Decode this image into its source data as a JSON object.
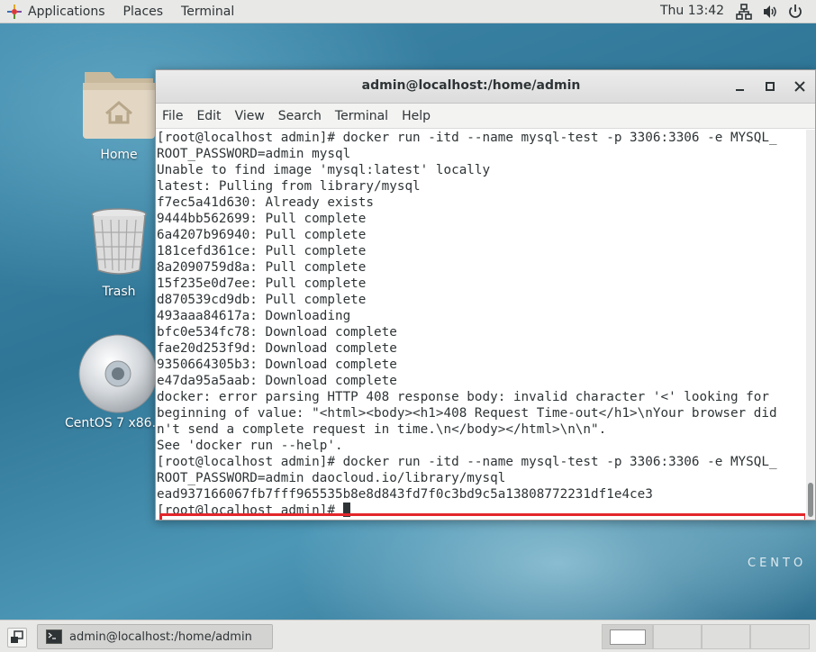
{
  "topbar": {
    "applications": "Applications",
    "places": "Places",
    "terminal": "Terminal",
    "clock": "Thu 13:42",
    "icons": [
      "network-icon",
      "volume-icon",
      "power-icon"
    ]
  },
  "desktop": {
    "icons": [
      {
        "label": "Home",
        "icon": "folder-home-icon"
      },
      {
        "label": "Trash",
        "icon": "trash-icon"
      },
      {
        "label": "CentOS 7 x86...",
        "icon": "disc-icon"
      }
    ],
    "brand": "CENTO"
  },
  "window": {
    "title": "admin@localhost:/home/admin",
    "menu": [
      "File",
      "Edit",
      "View",
      "Search",
      "Terminal",
      "Help"
    ],
    "lines": [
      "[root@localhost admin]# docker run -itd --name mysql-test -p 3306:3306 -e MYSQL_",
      "ROOT_PASSWORD=admin mysql",
      "Unable to find image 'mysql:latest' locally",
      "latest: Pulling from library/mysql",
      "f7ec5a41d630: Already exists",
      "9444bb562699: Pull complete",
      "6a4207b96940: Pull complete",
      "181cefd361ce: Pull complete",
      "8a2090759d8a: Pull complete",
      "15f235e0d7ee: Pull complete",
      "d870539cd9db: Pull complete",
      "493aaa84617a: Downloading",
      "bfc0e534fc78: Download complete",
      "fae20d253f9d: Download complete",
      "9350664305b3: Download complete",
      "e47da95a5aab: Download complete",
      "docker: error parsing HTTP 408 response body: invalid character '<' looking for",
      "beginning of value: \"<html><body><h1>408 Request Time-out</h1>\\nYour browser did",
      "n't send a complete request in time.\\n</body></html>\\n\\n\".",
      "See 'docker run --help'.",
      "[root@localhost admin]# docker run -itd --name mysql-test -p 3306:3306 -e MYSQL_",
      "ROOT_PASSWORD=admin daocloud.io/library/mysql",
      "ead937166067fb7fff965535b8e8d843fd7f0c3bd9c5a13808772231df1e4ce3"
    ],
    "prompt": "[root@localhost admin]# ",
    "highlight_color": "#e3262b"
  },
  "taskbar": {
    "task_label": "admin@localhost:/home/admin",
    "workspaces": 4,
    "active_workspace": 1
  }
}
